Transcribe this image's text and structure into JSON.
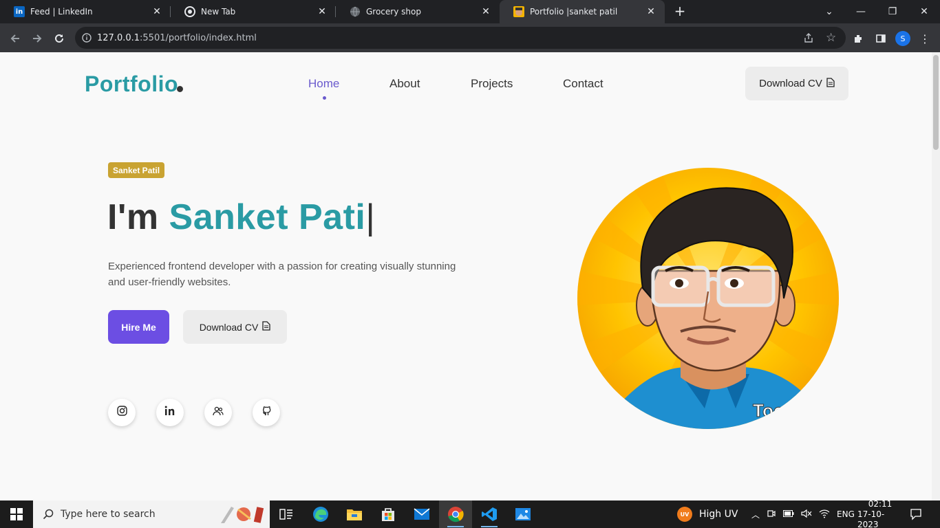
{
  "browser": {
    "tabs": [
      {
        "title": "Feed | LinkedIn",
        "icon": "linkedin-icon"
      },
      {
        "title": "New Tab",
        "icon": "chrome-icon"
      },
      {
        "title": "Grocery shop",
        "icon": "globe-icon"
      },
      {
        "title": "Portfolio |sanket patil",
        "icon": "avatar-favicon",
        "active": true
      }
    ],
    "url_host": "127.0.0.1",
    "url_rest": ":5501/portfolio/index.html",
    "profile_initial": "S"
  },
  "header": {
    "logo": "Portfolio",
    "nav": [
      "Home",
      "About",
      "Projects",
      "Contact"
    ],
    "active_nav": "Home",
    "cv_button": "Download CV"
  },
  "hero": {
    "badge": "Sanket Patil",
    "title_prefix": "I'm",
    "title_name": "Sanket Pati",
    "title_cursor": "|",
    "description": "Experienced frontend developer with a passion for creating visually stunning and user-friendly websites.",
    "hire_button": "Hire Me",
    "cv_button": "Download CV",
    "socials": [
      "instagram-icon",
      "linkedin-icon",
      "community-icon",
      "github-icon"
    ],
    "avatar_caption": "Too"
  },
  "colors": {
    "accent_teal": "#2a9ba4",
    "accent_purple": "#6c4ee3",
    "badge_gold": "#c9a332"
  },
  "taskbar": {
    "search_placeholder": "Type here to search",
    "weather": "High UV",
    "weather_badge": "UV",
    "language": "ENG",
    "time": "02:11",
    "date": "17-10-2023"
  }
}
